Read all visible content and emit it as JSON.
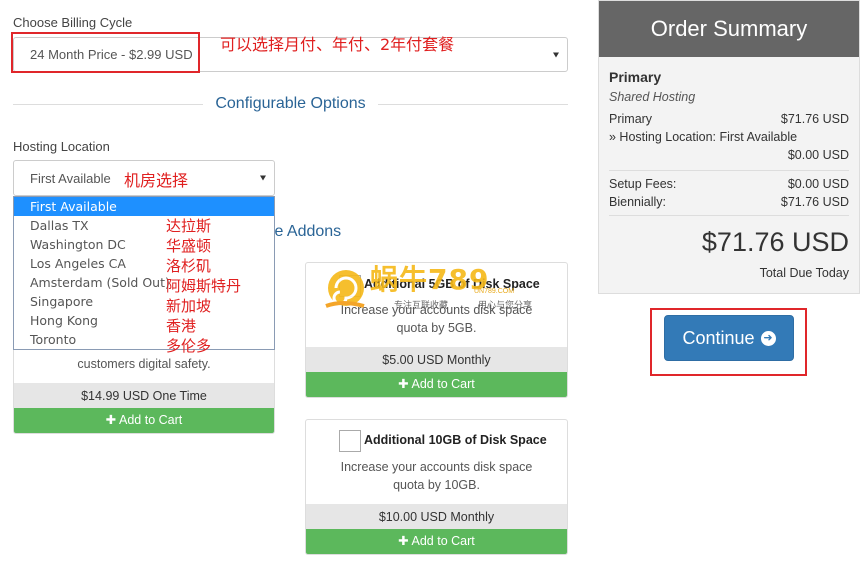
{
  "billing": {
    "label": "Choose Billing Cycle",
    "selected": "24 Month Price - $2.99 USD",
    "annotation": "可以选择月付、年付、2年付套餐"
  },
  "configurable_options_title": "Configurable Options",
  "hosting_location": {
    "label": "Hosting Location",
    "selected": "First Available",
    "annotation": "机房选择",
    "options": [
      {
        "label": "First Available",
        "cn": ""
      },
      {
        "label": "Dallas TX",
        "cn": "达拉斯"
      },
      {
        "label": "Washington DC",
        "cn": "华盛顿"
      },
      {
        "label": "Los Angeles CA",
        "cn": "洛杉矶"
      },
      {
        "label": "Amsterdam (Sold Out)",
        "cn": "阿姆斯特丹"
      },
      {
        "label": "Singapore",
        "cn": "新加坡"
      },
      {
        "label": "Hong Kong",
        "cn": "香港"
      },
      {
        "label": "Toronto",
        "cn": "多伦多"
      }
    ]
  },
  "addons_title_partial": "ble Addons",
  "addon_left": {
    "desc_partial": "customers digital safety.",
    "price": "$14.99 USD One Time",
    "cart": "Add to Cart"
  },
  "addon_5gb": {
    "name": "Additional 5GB of Disk Space",
    "desc": "Increase your accounts disk space quota by 5GB.",
    "price": "$5.00 USD Monthly",
    "cart": "Add to Cart"
  },
  "addon_10gb": {
    "name": "Additional 10GB of Disk Space",
    "desc": "Increase your accounts disk space quota by 10GB.",
    "price": "$10.00 USD Monthly",
    "cart": "Add to Cart"
  },
  "watermark": {
    "logo": "蜗牛789",
    "domain": "UN789.COM",
    "slogan1": "专注互联收藏",
    "slogan2": "用心与您分享"
  },
  "summary": {
    "title": "Order Summary",
    "product": "Primary",
    "group": "Shared Hosting",
    "line_item": "Primary",
    "line_price": "$71.76 USD",
    "option_line": "» Hosting Location: First Available",
    "option_price": "$0.00 USD",
    "setup_label": "Setup Fees:",
    "setup_value": "$0.00 USD",
    "cycle_label": "Biennially:",
    "cycle_value": "$71.76 USD",
    "total": "$71.76 USD",
    "total_label": "Total Due Today"
  },
  "continue_label": "Continue"
}
